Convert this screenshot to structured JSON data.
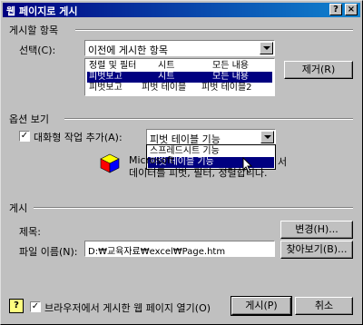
{
  "window": {
    "title": "웹 페이지로 게시",
    "help_btn": "?",
    "close_btn": "×"
  },
  "publish_section": {
    "header": "게시할 항목",
    "select_label": "선택(C):",
    "select_value": "이전에 게시한 항목",
    "items": [
      {
        "c1": "정렬 및 필터",
        "c2": "시트",
        "c3": "모든 내용",
        "selected": false
      },
      {
        "c1": "피벗보고",
        "c2": "시트",
        "c3": "모든 내용",
        "selected": true
      },
      {
        "c1": "피벗보고",
        "c2": "피벗 테이블",
        "c3": "피벗 테이블2",
        "selected": false
      }
    ],
    "remove_button": "제거(R)"
  },
  "options_section": {
    "header": "옵션 보기",
    "interactive_label": "대화형 작업 추가(A):",
    "interactive_checked": true,
    "type_value": "피벗 테이블 기능",
    "dropdown_options": [
      "스프레드시트 기능",
      "피벗 테이블 기능"
    ],
    "dropdown_selected_index": 1,
    "description_line1": "Microsoft",
    "description_suffix": "서",
    "description_line2": "데이터를 피벗, 필터, 정렬합니다."
  },
  "publish_as_section": {
    "header": "게시",
    "title_label": "제목:",
    "change_button": "변경(H)...",
    "filename_label": "파일 이름(N):",
    "filename_value": "D:₩교육자료₩excel₩Page.htm",
    "browse_button": "찾아보기(B)..."
  },
  "footer": {
    "open_in_browser_label": "브라우저에서 게시한 웹 페이지 열기(O)",
    "open_in_browser_checked": true,
    "publish_button": "게시(P)",
    "cancel_button": "취소"
  }
}
